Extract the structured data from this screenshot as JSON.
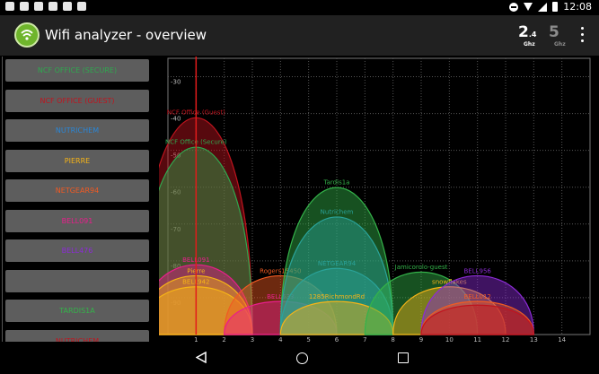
{
  "statusbar": {
    "time": "12:08"
  },
  "toolbar": {
    "title": "Wifi analyzer - overview",
    "band_24_big": "2",
    "band_24_sup": ".4",
    "band_5_big": "5",
    "ghz_label": "Ghz"
  },
  "networks": [
    {
      "label": "NCF OFFICE (SECURE)",
      "color": "#2fa84f"
    },
    {
      "label": "NCF OFFICE (GUEST)",
      "color": "#c0141e"
    },
    {
      "label": "NUTRICHEM",
      "color": "#2a86d6"
    },
    {
      "label": "PIERRE",
      "color": "#f6b417"
    },
    {
      "label": "NETGEAR94",
      "color": "#f15a22"
    },
    {
      "label": "BELL091",
      "color": "#e91e8c"
    },
    {
      "label": "BELL476",
      "color": "#8c2bd6"
    },
    {
      "label": "",
      "color": "#5d5d5d"
    },
    {
      "label": "TARDIS1A",
      "color": "#34b34a"
    },
    {
      "label": "NUTRICHEM",
      "color": "#c0141e"
    }
  ],
  "chart_data": {
    "type": "area",
    "xlim": [
      0,
      15
    ],
    "ylim": [
      -100,
      -25
    ],
    "x_ticks": [
      "1",
      "2",
      "3",
      "4",
      "5",
      "6",
      "7",
      "8",
      "9",
      "10",
      "11",
      "12",
      "13",
      "14"
    ],
    "y_ticks": [
      "-30",
      "-40",
      "-50",
      "-60",
      "-70",
      "-80",
      "-90"
    ],
    "selected_channel": 1,
    "series": [
      {
        "name": "NCF Office (Guest)",
        "channel": 1,
        "width": 2,
        "level": -41,
        "color": "#c0141e"
      },
      {
        "name": "NCF Office (Secure)",
        "channel": 1,
        "width": 2,
        "level": -49,
        "color": "#2fa84f"
      },
      {
        "name": "BELL091",
        "channel": 1,
        "width": 2,
        "level": -81,
        "color": "#e91e8c"
      },
      {
        "name": "Pierre",
        "channel": 1,
        "width": 2,
        "level": -84,
        "color": "#f6b417"
      },
      {
        "name": "BELL942",
        "channel": 1,
        "width": 2,
        "level": -87,
        "color": "#f6b417"
      },
      {
        "name": "Rogers15450",
        "channel": 4,
        "width": 2,
        "level": -84,
        "color": "#f15a22"
      },
      {
        "name": "BELL633",
        "channel": 4,
        "width": 2,
        "level": -91,
        "color": "#e91e8c"
      },
      {
        "name": "Tardis1a",
        "channel": 6,
        "width": 2,
        "level": -60,
        "color": "#34b34a"
      },
      {
        "name": "Nutrichem",
        "channel": 6,
        "width": 2,
        "level": -68,
        "color": "#2aa39a"
      },
      {
        "name": "NETGEAR94",
        "channel": 6,
        "width": 2,
        "level": -82,
        "color": "#2aa39a"
      },
      {
        "name": "1285RichmondRd",
        "channel": 6,
        "width": 2,
        "level": -91,
        "color": "#f6b417"
      },
      {
        "name": "Jamicorolo-guest",
        "channel": 9,
        "width": 2,
        "level": -83,
        "color": "#34b34a"
      },
      {
        "name": "snowflakes",
        "channel": 10,
        "width": 2,
        "level": -87,
        "color": "#f6b417"
      },
      {
        "name": "BELL956",
        "channel": 11,
        "width": 2,
        "level": -84,
        "color": "#8c2bd6"
      },
      {
        "name": "BELL012",
        "channel": 11,
        "width": 2,
        "level": -91,
        "color": "#f15a22"
      },
      {
        "name": "",
        "channel": 11,
        "width": 2,
        "level": -92,
        "color": "#c0141e"
      }
    ]
  }
}
